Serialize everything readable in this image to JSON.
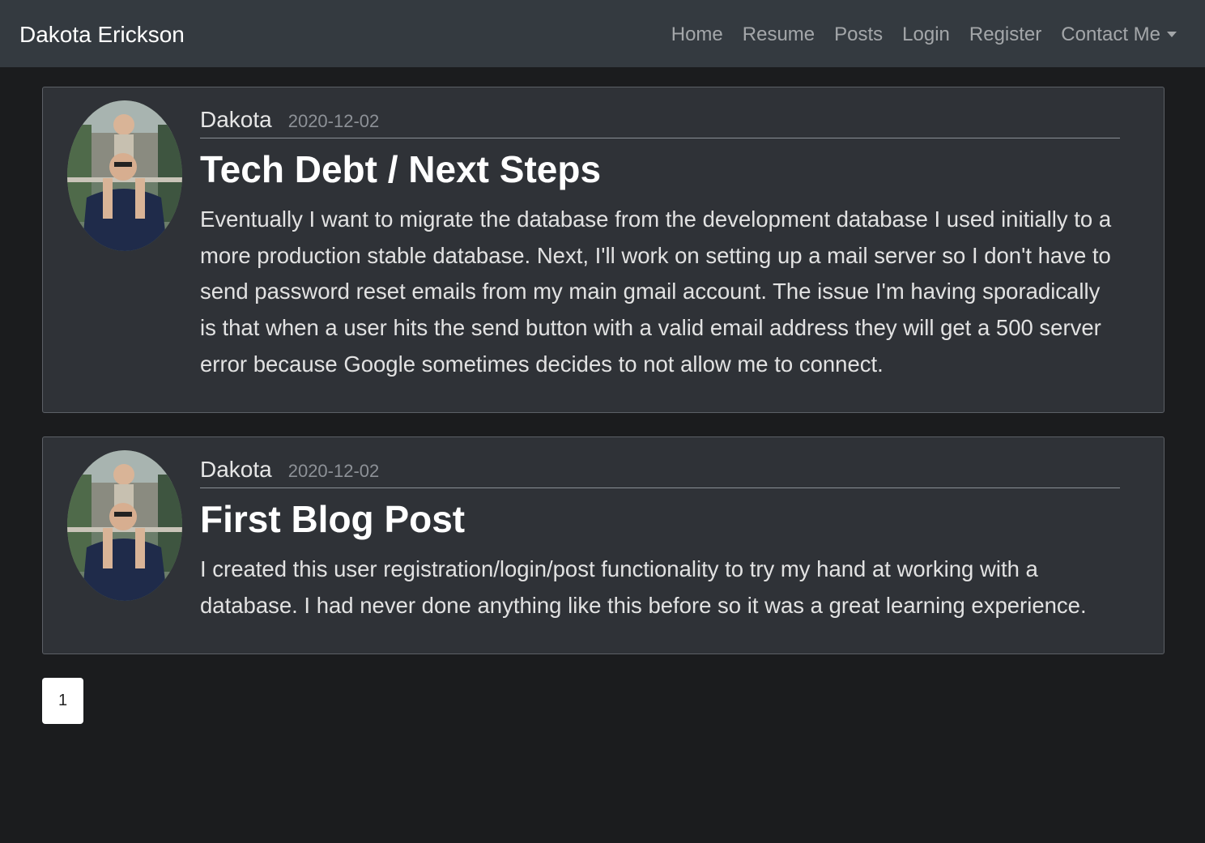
{
  "nav": {
    "brand": "Dakota Erickson",
    "links": [
      "Home",
      "Resume",
      "Posts",
      "Login",
      "Register"
    ],
    "dropdown": "Contact Me"
  },
  "posts": [
    {
      "author": "Dakota",
      "date": "2020-12-02",
      "title": "Tech Debt / Next Steps",
      "content": "Eventually I want to migrate the database from the development database I used initially to a more production stable database. Next, I'll work on setting up a mail server so I don't have to send password reset emails from my main gmail account. The issue I'm having sporadically is that when a user hits the send button with a valid email address they will get a 500 server error because Google sometimes decides to not allow me to connect."
    },
    {
      "author": "Dakota",
      "date": "2020-12-02",
      "title": "First Blog Post",
      "content": "I created this user registration/login/post functionality to try my hand at working with a database. I had never done anything like this before so it was a great learning experience."
    }
  ],
  "pagination": {
    "current_page": "1"
  },
  "colors": {
    "navbar_bg": "#343a40",
    "page_bg": "#1b1c1e",
    "card_bg": "#2f3237"
  }
}
